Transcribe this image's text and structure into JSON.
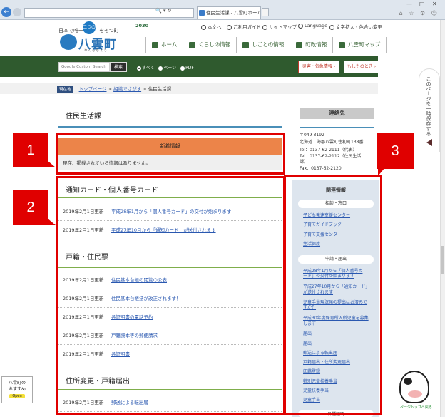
{
  "browser": {
    "back_glyph": "←",
    "address_tools": "🔍 ▾ ↻",
    "tab_title": "住民生活課 - 八雲町ホームペ...",
    "window_controls": [
      "—",
      "□",
      "✕"
    ],
    "chrome_icons": "⌂ ☆ ⚙ ☺"
  },
  "header": {
    "logo_subtitle": "日本で唯一",
    "logo_bubble": "二つの海",
    "logo_suffix": "をもつ町",
    "logo_name": "八雲町",
    "logo_kana": "やくもちょう",
    "year_badge": "2030",
    "utility_links": [
      "本文へ",
      "ご利用ガイド",
      "サイトマップ",
      "Language",
      "文字拡大・色合い変更"
    ]
  },
  "nav": {
    "items": [
      "ホーム",
      "くらしの情報",
      "しごとの情報",
      "町政情報",
      "八雲町マップ"
    ]
  },
  "search": {
    "placeholder": "Google Custom Search",
    "button": "検索",
    "options": [
      "すべて",
      "ページ",
      "PDF"
    ]
  },
  "header_buttons": {
    "disaster": "災害・気象情報 ›",
    "emergency": "もしものとき ›"
  },
  "side_tab": {
    "label": "このページを一時保存する"
  },
  "breadcrumb": {
    "current_label": "現在地",
    "items": [
      "トップページ",
      "組織でさがす"
    ],
    "current": "住民生活課",
    "separator": ">"
  },
  "page": {
    "title": "住民生活課"
  },
  "news": {
    "heading": "新着情報",
    "body": "現在、掲載されている情報はありません。"
  },
  "sections": [
    {
      "title": "通知カード・個人番号カード",
      "rows": [
        {
          "date": "2019年2月1日更新",
          "link": "平成28年1月から「個人番号カード」の交付が始まります"
        },
        {
          "date": "2019年2月1日更新",
          "link": "平成27年10月から「通知カード」が送付されます"
        }
      ]
    },
    {
      "title": "戸籍・住民票",
      "rows": [
        {
          "date": "2019年2月1日更新",
          "link": "住民基本台帳の閲覧の公表"
        },
        {
          "date": "2019年2月1日更新",
          "link": "住民基本台帳法が改正されます！"
        },
        {
          "date": "2019年2月1日更新",
          "link": "各証明書の電話予約"
        },
        {
          "date": "2019年2月1日更新",
          "link": "戸籍謄本等の郵便請求"
        },
        {
          "date": "2019年2月1日更新",
          "link": "各証明書"
        }
      ]
    },
    {
      "title": "住所変更・戸籍届出",
      "rows": [
        {
          "date": "2019年2月1日更新",
          "link": "郵送による転出届"
        }
      ]
    }
  ],
  "contact": {
    "heading": "連絡先",
    "lines": [
      "〒049-3192",
      "北海道二海郡八雲町住初町138番",
      "Tel：0137-62-2111（代表）",
      "Tel：0137-62-2112（住民生活",
      "課）",
      "Fax：0137-62-2120"
    ]
  },
  "related": {
    "heading": "関連情報",
    "categories": [
      {
        "name": "相談・窓口",
        "links": [
          "子ども発達支援センター",
          "子育てガイドブック",
          "子育て支援センター",
          "生活保護"
        ]
      },
      {
        "name": "申請・届出",
        "links": [
          "平成28年1月から「個人番号カ",
          "ード」の交付が始まります",
          "平成27年10月から「通知カード」",
          "が送付されます",
          "児童手当現況届の提出はお済みで",
          "すか？",
          "平成30年度保育所入所児童を募集",
          "します",
          "届出",
          "届出",
          "郵送による転出届",
          "戸籍届出・住所変更届出",
          "印鑑登録",
          "特別児童扶養手当",
          "児童扶養手当",
          "児童手当"
        ]
      }
    ],
    "footer_fragment": "各種証明"
  },
  "annotations": [
    "1",
    "2",
    "3"
  ],
  "widgets": {
    "recommend_title": "八雲町の",
    "recommend_title2": "おすすめ",
    "recommend_open": "Open",
    "mascot_label": "ページトップへ戻る"
  },
  "colors": {
    "green_bar": "#2f5a2e",
    "news_orange": "#ec8449",
    "annotation_red": "#e00000",
    "link_blue": "#2a58b0",
    "related_bg": "#dde5ee"
  }
}
